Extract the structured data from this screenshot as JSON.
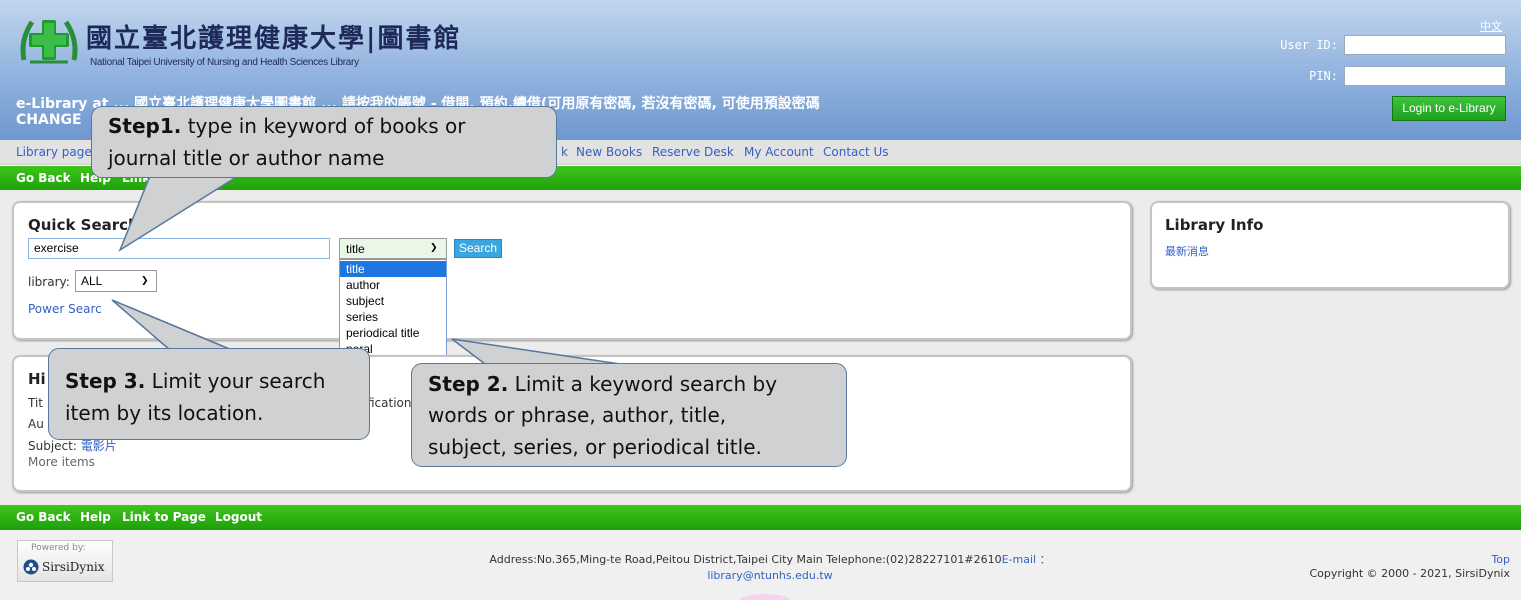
{
  "header": {
    "logo_title": "國立臺北護理健康大學|圖書館",
    "logo_subtitle": "National Taipei University of Nursing and Health Sciences Library",
    "lang_link": "中文",
    "userid_label": "User ID:",
    "pin_label": "PIN:",
    "login_button": "Login to e-Library",
    "elib_line1": "e-Library at ... 國立臺北護理健康大學圖書館 ... 請按我的帳號 - 借閱, 預約,續借(可用原有密碼, 若沒有密碼, 可使用預設密碼",
    "elib_line2": "CHANGE"
  },
  "nav": {
    "items": [
      "Library page",
      "k",
      "New Books",
      "Reserve Desk",
      "My Account",
      "Contact Us"
    ]
  },
  "greenbar_top": [
    "Go Back",
    "Help",
    "Link to"
  ],
  "greenbar_bottom": [
    "Go Back",
    "Help",
    "Link to Page",
    "Logout"
  ],
  "quick_search": {
    "title": "Quick Search",
    "keyword_value": "exercise",
    "field_selected": "title",
    "search_button": "Search",
    "options": [
      "title",
      "author",
      "subject",
      "series",
      "periodical title",
      "general"
    ],
    "options_visible": [
      "title",
      "author",
      "subject",
      "series",
      "periodical title",
      "neral"
    ],
    "library_label": "library:",
    "library_selected": "ALL",
    "power_search": "Power Searc"
  },
  "hi_panel": {
    "title": "Hi",
    "line_tit": "Tit",
    "line_au": "Au",
    "subject_label": "Subject:",
    "subject_link": "電影片",
    "fication": "fication",
    "more_items": "More items"
  },
  "library_info": {
    "title": "Library Info",
    "news_link": "最新消息"
  },
  "callouts": {
    "step1_bold": "Step1.",
    "step1_rest1": " type in keyword of books or",
    "step1_line2": "journal title or author name",
    "step2_bold": "Step 2.",
    "step2_rest1": " Limit a keyword search by",
    "step2_line2": "words or phrase, author, title,",
    "step2_line3": "subject, series, or periodical title.",
    "step3_bold": "Step 3.",
    "step3_rest1": " Limit your search",
    "step3_line2": "item by its location."
  },
  "footer": {
    "powered_by": "Powered by:",
    "sirsi": "SirsiDynix",
    "address_line1": "Address:No.365,Ming-te Road,Peitou District,Taipei City Main Telephone:(02)28227101#2610",
    "email_label": "E-mail ：",
    "email": "library@ntunhs.edu.tw",
    "top_link": "Top",
    "copyright": "Copyright © 2000 - 2021, SirsiDynix"
  },
  "colors": {
    "header_blue": "#8fb2de",
    "green_bar": "#2fb012",
    "link_blue": "#3361c4",
    "callout_fill": "#cfd1d3",
    "callout_border": "#56789c"
  }
}
